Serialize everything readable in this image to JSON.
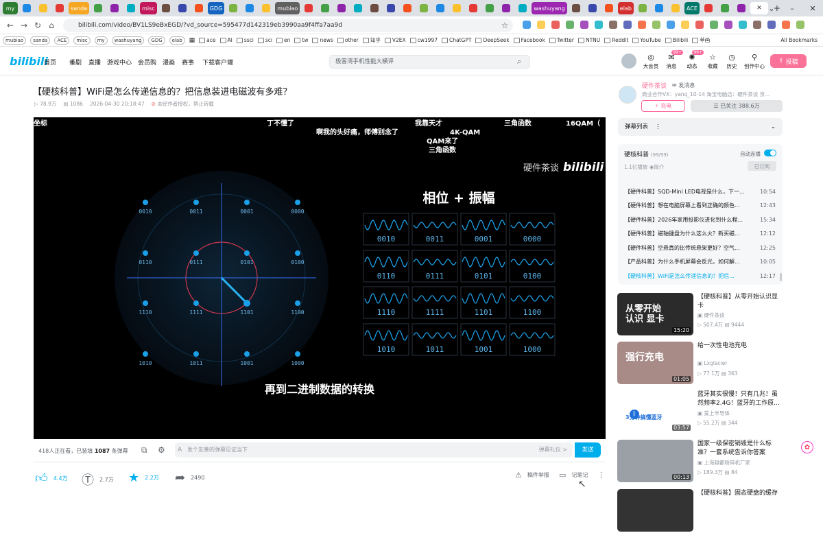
{
  "browser": {
    "tabs": [
      {
        "label": "my",
        "color": "#2e7d32"
      },
      {
        "label": "sanda",
        "color": "#f5a623"
      },
      {
        "label": "misc",
        "color": "#c2185b"
      },
      {
        "label": "GDG",
        "color": "#1565c0"
      },
      {
        "label": "mubiao",
        "color": "#616161"
      },
      {
        "label": "washuyang",
        "color": "#9c27b0"
      },
      {
        "label": "elab",
        "color": "#d32f2f"
      },
      {
        "label": "ACE",
        "color": "#00796b"
      }
    ],
    "url": "bilibili.com/video/BV1LS9eBxEGD/?vd_source=595477d142319eb3990aa9f4ffa7aa9d",
    "bookmark_badges": [
      "mubiao",
      "sanda",
      "ACE",
      "misc",
      "my",
      "washuyang",
      "GDG",
      "elab"
    ],
    "bookmarks": [
      "ace",
      "AI",
      "ssci",
      "sci",
      "en",
      "tw",
      "news",
      "other",
      "知乎",
      "V2EX",
      "cw1997",
      "ChatGPT",
      "DeepSeek",
      "Facebook",
      "Twitter",
      "NTNU",
      "Reddit",
      "YouTube",
      "Bilibili",
      "苹画"
    ],
    "all_bookmarks": "All Bookmarks"
  },
  "header": {
    "logo": "bilibili",
    "nav": [
      "首页",
      "番剧",
      "直播",
      "游戏中心",
      "会员购",
      "漫画",
      "赛事",
      "下载客户端"
    ],
    "search_placeholder": "极客湾手机性能大横评",
    "icons": [
      {
        "label": "大会员",
        "glyph": "◎"
      },
      {
        "label": "消息",
        "glyph": "✉",
        "badge": "99+"
      },
      {
        "label": "动态",
        "glyph": "✺",
        "badge": "99+"
      },
      {
        "label": "收藏",
        "glyph": "☆"
      },
      {
        "label": "历史",
        "glyph": "◷"
      },
      {
        "label": "创作中心",
        "glyph": "⚲"
      }
    ],
    "upload": "投稿"
  },
  "video": {
    "title": "【硬核科普】WiFi是怎么传递信息的？把信息装进电磁波有多难？",
    "views": "78.9万",
    "danmaku_count": "1086",
    "date": "2026-04-30 20:18:47",
    "copyright": "未经作者授权，禁止转载"
  },
  "player": {
    "danmaku": [
      "坐标",
      "丁不懂了",
      "啊我的头好痛，师傅别念了",
      "我靠天才",
      "4K-QAM",
      "QAM来了",
      "三角函数",
      "三角函数",
      "16QAM（"
    ],
    "watermark": "硬件茶谈",
    "panel_title": "相位 + 振幅",
    "subtitle": "再到二进制数据的转换",
    "constellation": [
      [
        "0010",
        "0011",
        "0001",
        "0000"
      ],
      [
        "0110",
        "0111",
        "0101",
        "0100"
      ],
      [
        "1110",
        "1111",
        "1101",
        "1100"
      ],
      [
        "1010",
        "1011",
        "1001",
        "1000"
      ]
    ]
  },
  "danmaku_bar": {
    "watching": "418人正在看，已装填",
    "count": "1087",
    "count_suffix": "条弹幕",
    "placeholder": "发个友善的弹幕见证当下",
    "etiquette": "弹幕礼仪 >",
    "send": "发送"
  },
  "actions": {
    "like": "4.4万",
    "coin": "2.7万",
    "fav": "2.2万",
    "share": "2490",
    "report": "稿件举报",
    "notes": "记笔记"
  },
  "uploader": {
    "name": "硬件茶谈",
    "message_label": "发消息",
    "desc": "商业合作VX：yanq_10-14 淘宝电脑店：硬件茶谈 京...",
    "charge": "充电",
    "followed": "已关注 388.6万"
  },
  "danmaku_list": "弹幕列表",
  "series": {
    "title": "硬核科普",
    "count": "(99/99)",
    "autoplay": "自动连播",
    "plays": "1.1亿播放",
    "intro": "简介",
    "subscribed": "已订阅",
    "episodes": [
      {
        "title": "【硬件科普】SQD-Mini LED电视是什么，下一...",
        "dur": "10:54"
      },
      {
        "title": "【硬件科普】想在电脑屏幕上看到正确的颜色...",
        "dur": "12:43"
      },
      {
        "title": "【硬件科普】2026年家用投影仪进化到什么程...",
        "dur": "15:34"
      },
      {
        "title": "【硬件科普】磁轴键盘为什么这么火？新买磁...",
        "dur": "12:12"
      },
      {
        "title": "【硬件科普】空悬真的比传统悬架更好？空气...",
        "dur": "12:25"
      },
      {
        "title": "【产品科普】为什么手机屏幕会反光，如何解...",
        "dur": "10:05"
      },
      {
        "title": "【硬核科普】WiFi是怎么传递信息的？把信...",
        "dur": "12:17"
      }
    ]
  },
  "recommendations": [
    {
      "title": "【硬核科普】从零开始认识显卡",
      "up": "硬件茶谈",
      "views": "507.4万",
      "dm": "9444",
      "dur": "15:20",
      "thumb_text": "从零开始 认识 显卡",
      "bg": "#2b2b2b"
    },
    {
      "title": "给一次性电池充电",
      "up": "Lxglacier",
      "views": "77.1万",
      "dm": "363",
      "dur": "01:05",
      "thumb_text": "强行充电",
      "bg": "#a88a86"
    },
    {
      "title": "蓝牙其实很慢！只有几兆！虽然频率2.4G！蓝牙的工作原...",
      "up": "爱上半导体",
      "views": "55.2万",
      "dm": "344",
      "dur": "03:57",
      "thumb_text": "3分钟搞懂蓝牙",
      "bg": "#ffffff"
    },
    {
      "title": "国家一级保密销毁是什么标准？一套系统告诉你答案",
      "up": "上海越都粉碎机厂家",
      "views": "189.3万",
      "dm": "84",
      "dur": "00:13",
      "thumb_text": "",
      "bg": "#9aa0a6"
    },
    {
      "title": "【硬核科普】固态硬盘的缓存",
      "up": "",
      "views": "",
      "dm": "",
      "dur": "",
      "thumb_text": "",
      "bg": "#333"
    }
  ]
}
